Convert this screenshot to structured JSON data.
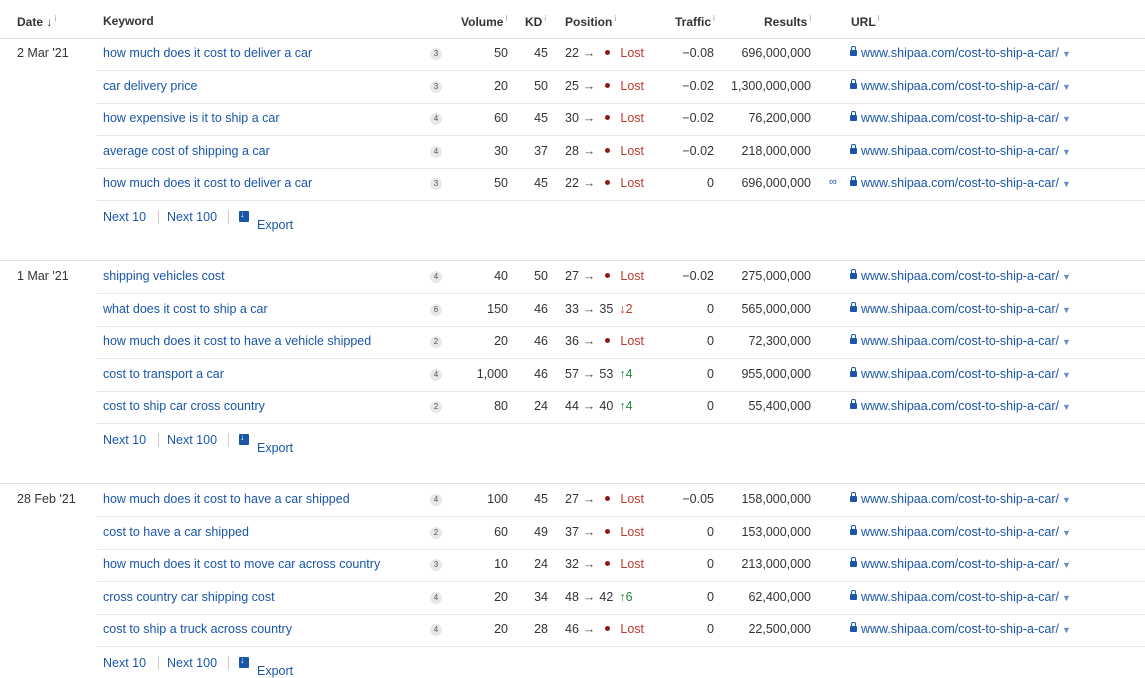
{
  "headers": {
    "date": "Date ↓",
    "keyword": "Keyword",
    "volume": "Volume",
    "kd": "KD",
    "position": "Position",
    "traffic": "Traffic",
    "results": "Results",
    "url": "URL",
    "info": "i"
  },
  "footer": {
    "next10": "Next 10",
    "next100": "Next 100",
    "export": "Export"
  },
  "groups": [
    {
      "date": "2 Mar '21",
      "rows": [
        {
          "keyword": "how much does it cost to deliver a car",
          "words": "3",
          "volume": "50",
          "kd": "45",
          "from": "22",
          "to": "",
          "change": "Lost",
          "dir": "lost",
          "traffic": "−0.08",
          "results": "696,000,000",
          "link": false,
          "url": "www.shipaa.com/cost-to-ship-a-car/"
        },
        {
          "keyword": "car delivery price",
          "words": "3",
          "volume": "20",
          "kd": "50",
          "from": "25",
          "to": "",
          "change": "Lost",
          "dir": "lost",
          "traffic": "−0.02",
          "results": "1,300,000,000",
          "link": false,
          "url": "www.shipaa.com/cost-to-ship-a-car/"
        },
        {
          "keyword": "how expensive is it to ship a car",
          "words": "4",
          "volume": "60",
          "kd": "45",
          "from": "30",
          "to": "",
          "change": "Lost",
          "dir": "lost",
          "traffic": "−0.02",
          "results": "76,200,000",
          "link": false,
          "url": "www.shipaa.com/cost-to-ship-a-car/"
        },
        {
          "keyword": "average cost of shipping a car",
          "words": "4",
          "volume": "30",
          "kd": "37",
          "from": "28",
          "to": "",
          "change": "Lost",
          "dir": "lost",
          "traffic": "−0.02",
          "results": "218,000,000",
          "link": false,
          "url": "www.shipaa.com/cost-to-ship-a-car/"
        },
        {
          "keyword": "how much does it cost to deliver a car",
          "words": "3",
          "volume": "50",
          "kd": "45",
          "from": "22",
          "to": "",
          "change": "Lost",
          "dir": "lost",
          "traffic": "0",
          "results": "696,000,000",
          "link": true,
          "url": "www.shipaa.com/cost-to-ship-a-car/"
        }
      ]
    },
    {
      "date": "1 Mar '21",
      "rows": [
        {
          "keyword": "shipping vehicles cost",
          "words": "4",
          "volume": "40",
          "kd": "50",
          "from": "27",
          "to": "",
          "change": "Lost",
          "dir": "lost",
          "traffic": "−0.02",
          "results": "275,000,000",
          "link": false,
          "url": "www.shipaa.com/cost-to-ship-a-car/"
        },
        {
          "keyword": "what does it cost to ship a car",
          "words": "6",
          "volume": "150",
          "kd": "46",
          "from": "33",
          "to": "35",
          "change": "2",
          "dir": "down",
          "traffic": "0",
          "results": "565,000,000",
          "link": false,
          "url": "www.shipaa.com/cost-to-ship-a-car/"
        },
        {
          "keyword": "how much does it cost to have a vehicle shipped",
          "words": "2",
          "volume": "20",
          "kd": "46",
          "from": "36",
          "to": "",
          "change": "Lost",
          "dir": "lost",
          "traffic": "0",
          "results": "72,300,000",
          "link": false,
          "url": "www.shipaa.com/cost-to-ship-a-car/"
        },
        {
          "keyword": "cost to transport a car",
          "words": "4",
          "volume": "1,000",
          "kd": "46",
          "from": "57",
          "to": "53",
          "change": "4",
          "dir": "up",
          "traffic": "0",
          "results": "955,000,000",
          "link": false,
          "url": "www.shipaa.com/cost-to-ship-a-car/"
        },
        {
          "keyword": "cost to ship car cross country",
          "words": "2",
          "volume": "80",
          "kd": "24",
          "from": "44",
          "to": "40",
          "change": "4",
          "dir": "up",
          "traffic": "0",
          "results": "55,400,000",
          "link": false,
          "url": "www.shipaa.com/cost-to-ship-a-car/"
        }
      ]
    },
    {
      "date": "28 Feb '21",
      "rows": [
        {
          "keyword": "how much does it cost to have a car shipped",
          "words": "4",
          "volume": "100",
          "kd": "45",
          "from": "27",
          "to": "",
          "change": "Lost",
          "dir": "lost",
          "traffic": "−0.05",
          "results": "158,000,000",
          "link": false,
          "url": "www.shipaa.com/cost-to-ship-a-car/"
        },
        {
          "keyword": "cost to have a car shipped",
          "words": "2",
          "volume": "60",
          "kd": "49",
          "from": "37",
          "to": "",
          "change": "Lost",
          "dir": "lost",
          "traffic": "0",
          "results": "153,000,000",
          "link": false,
          "url": "www.shipaa.com/cost-to-ship-a-car/"
        },
        {
          "keyword": "how much does it cost to move car across country",
          "words": "3",
          "volume": "10",
          "kd": "24",
          "from": "32",
          "to": "",
          "change": "Lost",
          "dir": "lost",
          "traffic": "0",
          "results": "213,000,000",
          "link": false,
          "url": "www.shipaa.com/cost-to-ship-a-car/"
        },
        {
          "keyword": "cross country car shipping cost",
          "words": "4",
          "volume": "20",
          "kd": "34",
          "from": "48",
          "to": "42",
          "change": "6",
          "dir": "up",
          "traffic": "0",
          "results": "62,400,000",
          "link": false,
          "url": "www.shipaa.com/cost-to-ship-a-car/"
        },
        {
          "keyword": "cost to ship a truck across country",
          "words": "4",
          "volume": "20",
          "kd": "28",
          "from": "46",
          "to": "",
          "change": "Lost",
          "dir": "lost",
          "traffic": "0",
          "results": "22,500,000",
          "link": false,
          "url": "www.shipaa.com/cost-to-ship-a-car/"
        }
      ]
    }
  ]
}
